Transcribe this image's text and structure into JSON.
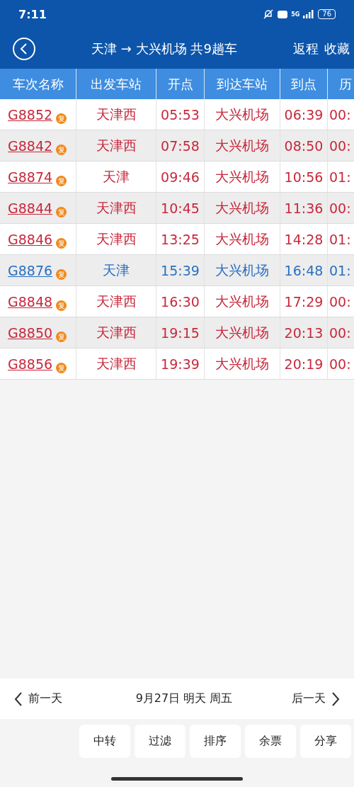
{
  "status_bar": {
    "time": "7:11",
    "network": "5G",
    "battery": "76"
  },
  "nav": {
    "title": "天津 → 大兴机场 共9趟车",
    "actions": [
      "返程",
      "收藏"
    ]
  },
  "table": {
    "columns": [
      "车次名称",
      "出发车站",
      "开点",
      "到达车站",
      "到点",
      "历"
    ],
    "rows": [
      {
        "train": "G8852",
        "badge": "复",
        "from": "天津西",
        "depart": "05:53",
        "to": "大兴机场",
        "arrive": "06:39",
        "column_6": "00:",
        "color": "#c8283c"
      },
      {
        "train": "G8842",
        "badge": "复",
        "from": "天津西",
        "depart": "07:58",
        "to": "大兴机场",
        "arrive": "08:50",
        "column_6": "00:",
        "color": "#c8283c"
      },
      {
        "train": "G8874",
        "badge": "复",
        "from": "天津",
        "depart": "09:46",
        "to": "大兴机场",
        "arrive": "10:56",
        "column_6": "01:",
        "color": "#c8283c"
      },
      {
        "train": "G8844",
        "badge": "复",
        "from": "天津西",
        "depart": "10:45",
        "to": "大兴机场",
        "arrive": "11:36",
        "column_6": "00:",
        "color": "#c8283c"
      },
      {
        "train": "G8846",
        "badge": "复",
        "from": "天津西",
        "depart": "13:25",
        "to": "大兴机场",
        "arrive": "14:28",
        "column_6": "01:",
        "color": "#c8283c"
      },
      {
        "train": "G8876",
        "badge": "复",
        "from": "天津",
        "depart": "15:39",
        "to": "大兴机场",
        "arrive": "16:48",
        "column_6": "01:",
        "color": "#2a6fc0"
      },
      {
        "train": "G8848",
        "badge": "复",
        "from": "天津西",
        "depart": "16:30",
        "to": "大兴机场",
        "arrive": "17:29",
        "column_6": "00:",
        "color": "#c8283c"
      },
      {
        "train": "G8850",
        "badge": "复",
        "from": "天津西",
        "depart": "19:15",
        "to": "大兴机场",
        "arrive": "20:13",
        "column_6": "00:",
        "color": "#c8283c"
      },
      {
        "train": "G8856",
        "badge": "复",
        "from": "天津西",
        "depart": "19:39",
        "to": "大兴机场",
        "arrive": "20:19",
        "column_6": "00:",
        "color": "#c8283c"
      }
    ]
  },
  "date_bar": {
    "prev": "前一天",
    "date": "9月27日 明天 周五",
    "next": "后一天"
  },
  "buttons": [
    "中转",
    "过滤",
    "排序",
    "余票",
    "分享"
  ]
}
